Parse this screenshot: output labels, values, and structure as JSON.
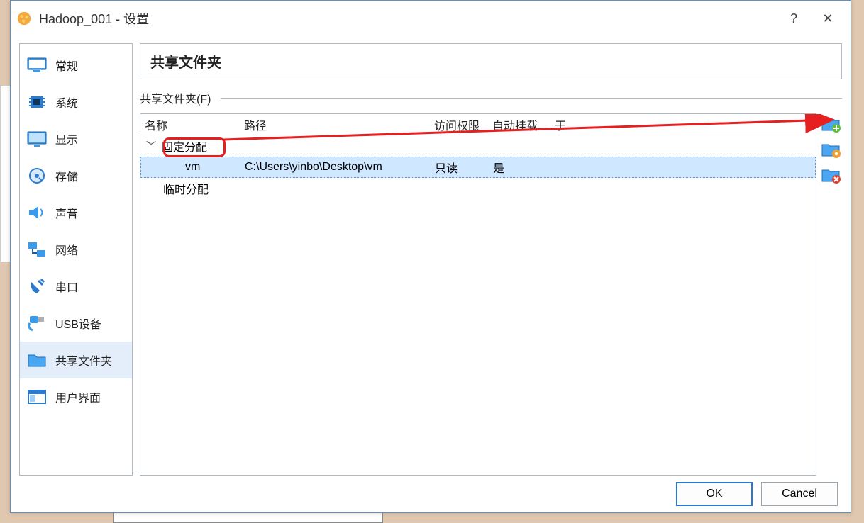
{
  "window": {
    "title": "Hadoop_001 - 设置",
    "help": "?",
    "close": "✕"
  },
  "sidebar": {
    "items": [
      {
        "label": "常规"
      },
      {
        "label": "系统"
      },
      {
        "label": "显示"
      },
      {
        "label": "存储"
      },
      {
        "label": "声音"
      },
      {
        "label": "网络"
      },
      {
        "label": "串口"
      },
      {
        "label": "USB设备"
      },
      {
        "label": "共享文件夹"
      },
      {
        "label": "用户界面"
      }
    ],
    "selected_index": 8
  },
  "main": {
    "header": "共享文件夹",
    "fieldset_label": "共享文件夹(F)",
    "columns": {
      "name": "名称",
      "path": "路径",
      "access": "访问权限",
      "automount": "自动挂载",
      "at": "于"
    },
    "groups": [
      {
        "label": "固定分配",
        "expanded": true,
        "highlighted": true,
        "rows": [
          {
            "name": "vm",
            "path": "C:\\Users\\yinbo\\Desktop\\vm",
            "access": "只读",
            "automount": "是",
            "at": "",
            "selected": true
          }
        ]
      },
      {
        "label": "临时分配",
        "expanded": false,
        "rows": []
      }
    ]
  },
  "footer": {
    "ok": "OK",
    "cancel": "Cancel"
  },
  "toolbar_icons": {
    "add": "folder-add-icon",
    "edit": "folder-edit-icon",
    "remove": "folder-remove-icon"
  }
}
